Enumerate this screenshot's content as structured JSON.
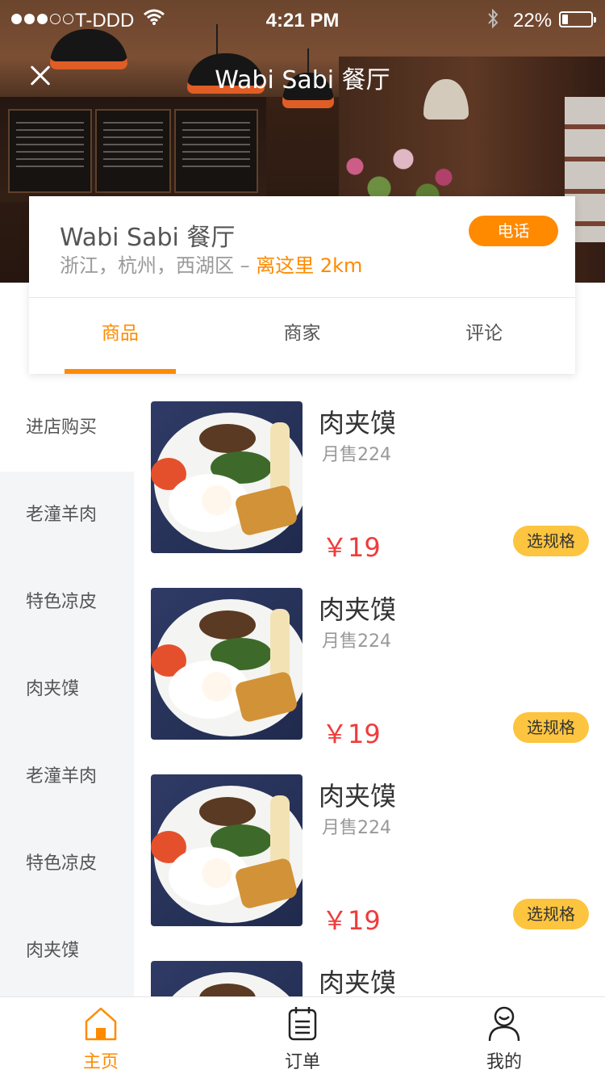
{
  "status_bar": {
    "carrier": "T-DDD",
    "time": "4:21 PM",
    "battery": "22%",
    "battery_level": 0.22,
    "signal_filled": 3,
    "signal_total": 5
  },
  "header": {
    "title": "Wabi Sabi 餐厅",
    "close_icon": "close-icon"
  },
  "shop": {
    "name": "Wabi Sabi 餐厅",
    "address": "浙江，杭州，西湖区 – ",
    "distance": "离这里 2km",
    "phone_label": "电话"
  },
  "tabs": [
    {
      "label": "商品",
      "active": true
    },
    {
      "label": "商家",
      "active": false
    },
    {
      "label": "评论",
      "active": false
    }
  ],
  "sidebar": {
    "items": [
      {
        "label": "进店购买",
        "active": true
      },
      {
        "label": "老潼羊肉",
        "active": false
      },
      {
        "label": "特色凉皮",
        "active": false
      },
      {
        "label": "肉夹馍",
        "active": false
      },
      {
        "label": "老潼羊肉",
        "active": false
      },
      {
        "label": "特色凉皮",
        "active": false
      },
      {
        "label": "肉夹馍",
        "active": false
      }
    ]
  },
  "products": [
    {
      "name": "肉夹馍",
      "sales": "月售224",
      "price": "￥19",
      "button": "选规格"
    },
    {
      "name": "肉夹馍",
      "sales": "月售224",
      "price": "￥19",
      "button": "选规格"
    },
    {
      "name": "肉夹馍",
      "sales": "月售224",
      "price": "￥19",
      "button": "选规格"
    },
    {
      "name": "肉夹馍",
      "sales": "",
      "price": "",
      "button": ""
    }
  ],
  "tabbar": {
    "items": [
      {
        "label": "主页",
        "icon": "home-icon",
        "active": true
      },
      {
        "label": "订单",
        "icon": "order-icon",
        "active": false
      },
      {
        "label": "我的",
        "icon": "user-icon",
        "active": false
      }
    ]
  },
  "colors": {
    "accent": "#ff8a00",
    "price": "#f03b3b",
    "spec_button": "#fdc43f"
  }
}
